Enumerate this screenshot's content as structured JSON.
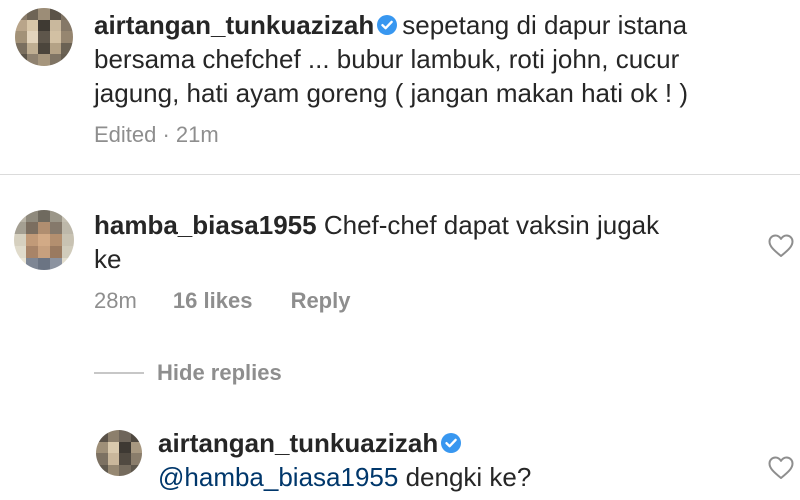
{
  "post": {
    "username": "airtangan_tunkuazizah",
    "caption_lines": [
      "sepetang di dapur istana",
      "bersama chefchef ... bubur lambuk, roti john, cucur",
      "jagung, hati ayam goreng ( jangan makan hati ok ! )"
    ],
    "edited_label": "Edited · 21m"
  },
  "comment": {
    "username": "hamba_biasa1955",
    "text_lines": [
      "Chef-chef dapat vaksin jugak",
      "ke"
    ],
    "time": "28m",
    "likes": "16 likes",
    "reply_label": "Reply"
  },
  "replies": {
    "toggle_label": "Hide replies",
    "items": [
      {
        "username": "airtangan_tunkuazizah",
        "mention": "@hamba_biasa1955",
        "text": " dengki ke?"
      }
    ]
  },
  "icons": {
    "verified": "verified-badge-icon",
    "like": "heart-icon"
  },
  "colors": {
    "verified_blue": "#3897f0",
    "mention": "#00376b",
    "muted": "#8e8e8e",
    "text": "#262626"
  }
}
